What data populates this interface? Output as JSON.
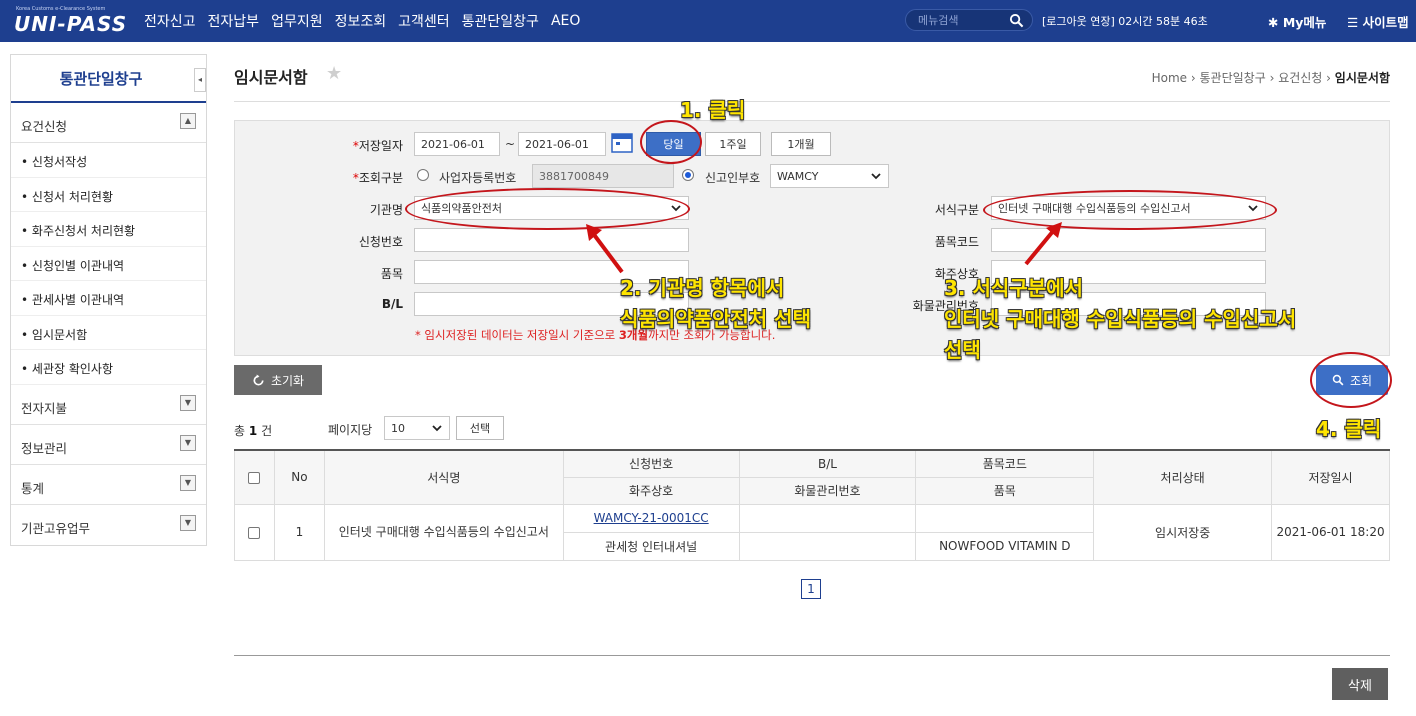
{
  "header": {
    "logo_small": "Korea Customs e-Clearance System",
    "logo": "UNI-PASS",
    "nav": [
      "전자신고",
      "전자납부",
      "업무지원",
      "정보조회",
      "고객센터",
      "통관단일창구",
      "AEO"
    ],
    "menu_search_placeholder": "메뉴검색",
    "timer": "[로그아웃 연장] 02시간 58분 46초",
    "my_menu": "My메뉴",
    "sitemap": "사이트맵"
  },
  "sidebar": {
    "title": "통관단일창구",
    "collapse_icon": "◂",
    "group_open": "요건신청",
    "sub_items": [
      "신청서작성",
      "신청서 처리현황",
      "화주신청서 처리현황",
      "신청인별 이관내역",
      "관세사별 이관내역",
      "임시문서함",
      "세관장 확인사항"
    ],
    "groups_closed": [
      "전자지불",
      "정보관리",
      "통계",
      "기관고유업무"
    ]
  },
  "page": {
    "title": "임시문서함",
    "breadcrumb": [
      "Home",
      "통관단일창구",
      "요건신청",
      "임시문서함"
    ]
  },
  "form": {
    "req_mark": "*",
    "save_date_label": "저장일자",
    "date_from": "2021-06-01",
    "date_sep": "~",
    "date_to": "2021-06-01",
    "btn_today": "당일",
    "btn_week": "1주일",
    "btn_month": "1개월",
    "search_type_label": "조회구분",
    "radio_biz": "사업자등록번호",
    "biz_no": "3881700849",
    "radio_declarant": "신고인부호",
    "declarant_code": "WAMCY",
    "agency_label": "기관명",
    "agency_value": "식품의약품안전처",
    "form_type_label": "서식구분",
    "form_type_value": "인터넷 구매대행 수입식품등의 수입신고서",
    "app_no_label": "신청번호",
    "item_code_label": "품목코드",
    "item_label": "품목",
    "owner_label": "화주상호",
    "bl_label": "B/L",
    "cargo_no_label": "화물관리번호",
    "notice_pre": "* 임시저장된 데이터는 저장일시 기준으로 ",
    "notice_bold": "3개월",
    "notice_post": "까지만 조회가 가능합니다."
  },
  "actions": {
    "reset": "초기화",
    "search": "조회",
    "delete": "삭제"
  },
  "list": {
    "total_pre": "총",
    "total_count": "1",
    "total_post": "건",
    "per_page_label": "페이지당",
    "per_page": "10",
    "select_btn": "선택",
    "headers": {
      "no": "No",
      "form_name": "서식명",
      "app_no": "신청번호",
      "bl": "B/L",
      "item_code": "품목코드",
      "owner": "화주상호",
      "cargo_no": "화물관리번호",
      "item": "품목",
      "status": "처리상태",
      "saved_at": "저장일시"
    },
    "rows": [
      {
        "no": "1",
        "form_name": "인터넷 구매대행 수입식품등의 수입신고서",
        "app_no": "WAMCY-21-0001CC",
        "bl": "",
        "item_code": "",
        "owner": "관세청 인터내셔널",
        "cargo_no": "",
        "item": "NOWFOOD VITAMIN D",
        "status": "임시저장중",
        "saved_at": "2021-06-01 18:20"
      }
    ],
    "page": "1"
  },
  "annotations": {
    "step1": "1. 클릭",
    "step2_line1": "2. 기관명 항목에서",
    "step2_line2": "식품의약품안전처 선택",
    "step3_line1": "3. 서식구분에서",
    "step3_line2": "인터넷 구매대행 수입식품등의 수입신고서",
    "step3_line3": "선택",
    "step4": "4. 클릭"
  },
  "colors": {
    "brand": "#1e3f8f",
    "primary_button": "#3d6fc6",
    "annotation_text": "#ffe500",
    "annotation_ring": "#c4161c",
    "notice": "#dd2222"
  }
}
